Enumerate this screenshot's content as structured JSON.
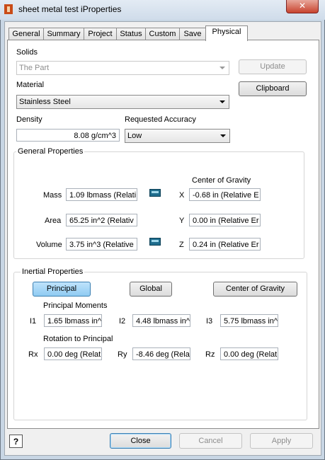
{
  "window": {
    "title": "sheet metal test iProperties",
    "close_glyph": "✕",
    "icon": "inventor-app-icon"
  },
  "tabs": [
    {
      "label": "General"
    },
    {
      "label": "Summary"
    },
    {
      "label": "Project"
    },
    {
      "label": "Status"
    },
    {
      "label": "Custom"
    },
    {
      "label": "Save"
    },
    {
      "label": "Physical",
      "active": true
    }
  ],
  "physical": {
    "solids_label": "Solids",
    "solids_value": "The Part",
    "update_button": "Update",
    "material_label": "Material",
    "material_value": "Stainless Steel",
    "clipboard_button": "Clipboard",
    "density_label": "Density",
    "density_value": "8.08 g/cm^3",
    "accuracy_label": "Requested Accuracy",
    "accuracy_value": "Low"
  },
  "general_properties": {
    "title": "General Properties",
    "cog_title": "Center of Gravity",
    "mass_label": "Mass",
    "mass_value": "1.09 lbmass (Relati",
    "area_label": "Area",
    "area_value": "65.25 in^2 (Relativ",
    "volume_label": "Volume",
    "volume_value": "3.75 in^3 (Relative",
    "x_label": "X",
    "x_value": "-0.68 in (Relative E",
    "y_label": "Y",
    "y_value": "0.00 in (Relative Er",
    "z_label": "Z",
    "z_value": "0.24 in (Relative Er"
  },
  "inertial_properties": {
    "title": "Inertial Properties",
    "principal_button": "Principal",
    "global_button": "Global",
    "cog_button": "Center of Gravity",
    "moments_title": "Principal Moments",
    "i1_label": "I1",
    "i1_value": "1.65 lbmass in^",
    "i2_label": "I2",
    "i2_value": "4.48 lbmass in^",
    "i3_label": "I3",
    "i3_value": "5.75 lbmass in^",
    "rotation_title": "Rotation to Principal",
    "rx_label": "Rx",
    "rx_value": "0.00 deg (Relat",
    "ry_label": "Ry",
    "ry_value": "-8.46 deg (Rela",
    "rz_label": "Rz",
    "rz_value": "0.00 deg (Relat"
  },
  "footer": {
    "help_glyph": "?",
    "close_button": "Close",
    "cancel_button": "Cancel",
    "apply_button": "Apply"
  }
}
